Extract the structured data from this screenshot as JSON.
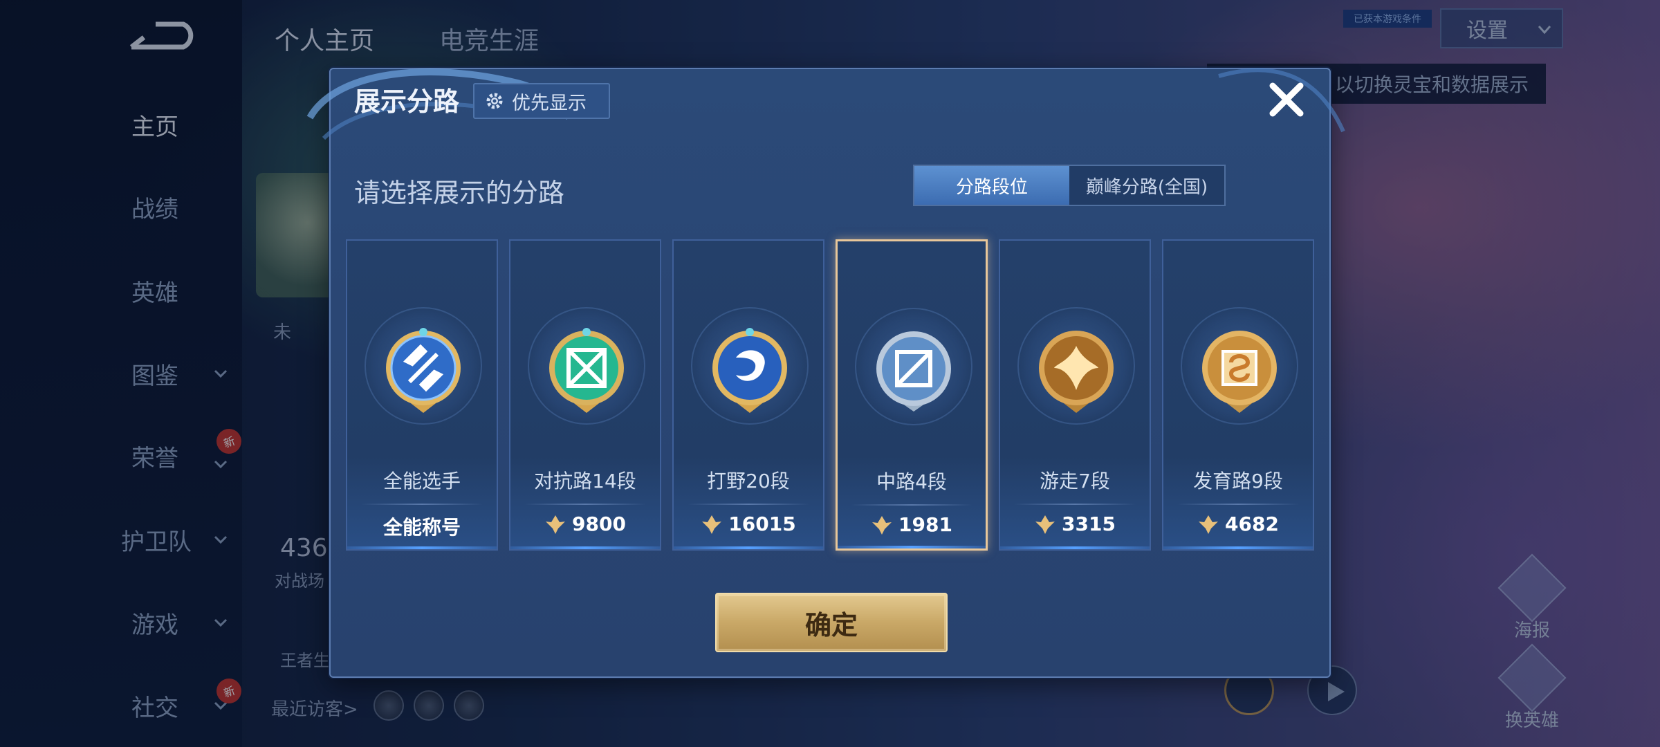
{
  "sidebar": {
    "items": [
      {
        "label": "主页",
        "active": true
      },
      {
        "label": "战绩"
      },
      {
        "label": "英雄"
      },
      {
        "label": "图鉴",
        "chevron": true
      },
      {
        "label": "荣誉",
        "chevron": true,
        "badge": "新"
      },
      {
        "label": "护卫队",
        "chevron": true
      },
      {
        "label": "游戏",
        "chevron": true
      },
      {
        "label": "社交",
        "chevron": true,
        "badge": "新"
      }
    ]
  },
  "background": {
    "tabs": [
      "个人主页",
      "电竞生涯"
    ],
    "settings_label": "设置",
    "tooltip_text": "以切换灵宝和数据展示",
    "tiny_label": "已获本游戏条件",
    "stat_number": "436",
    "stat_label": "对战场",
    "king_label": "王者生",
    "visitors_label": "最近访客>",
    "name_fragment": "未",
    "actions": [
      "海报",
      "换英雄"
    ],
    "new_badge": "新"
  },
  "modal": {
    "title": "展示分路",
    "priority_label": "优先显示",
    "subtitle": "请选择展示的分路",
    "toggle": {
      "options": [
        "分路段位",
        "巅峰分路(全国)"
      ],
      "selected": 0
    },
    "cards": [
      {
        "label": "全能选手",
        "score": "全能称号",
        "emblem": "all-round-emblem",
        "color": "#3a7fd6",
        "selected": false,
        "has_score_icon": false
      },
      {
        "label": "对抗路14段",
        "score": "9800",
        "emblem": "clash-lane-emblem",
        "color": "#2fb58c",
        "selected": false,
        "has_score_icon": true
      },
      {
        "label": "打野20段",
        "score": "16015",
        "emblem": "jungle-emblem",
        "color": "#2f6fcf",
        "selected": false,
        "has_score_icon": true
      },
      {
        "label": "中路4段",
        "score": "1981",
        "emblem": "mid-lane-emblem",
        "color": "#8fb3d8",
        "selected": true,
        "has_score_icon": true
      },
      {
        "label": "游走7段",
        "score": "3315",
        "emblem": "roam-emblem",
        "color": "#c99246",
        "selected": false,
        "has_score_icon": true
      },
      {
        "label": "发育路9段",
        "score": "4682",
        "emblem": "farm-lane-emblem",
        "color": "#d7a55a",
        "selected": false,
        "has_score_icon": true
      }
    ],
    "confirm_label": "确定"
  },
  "colors": {
    "accent_gold": "#e3c98f",
    "toggle_active": "#4a7fc4",
    "modal_bg": "#2a4674"
  }
}
